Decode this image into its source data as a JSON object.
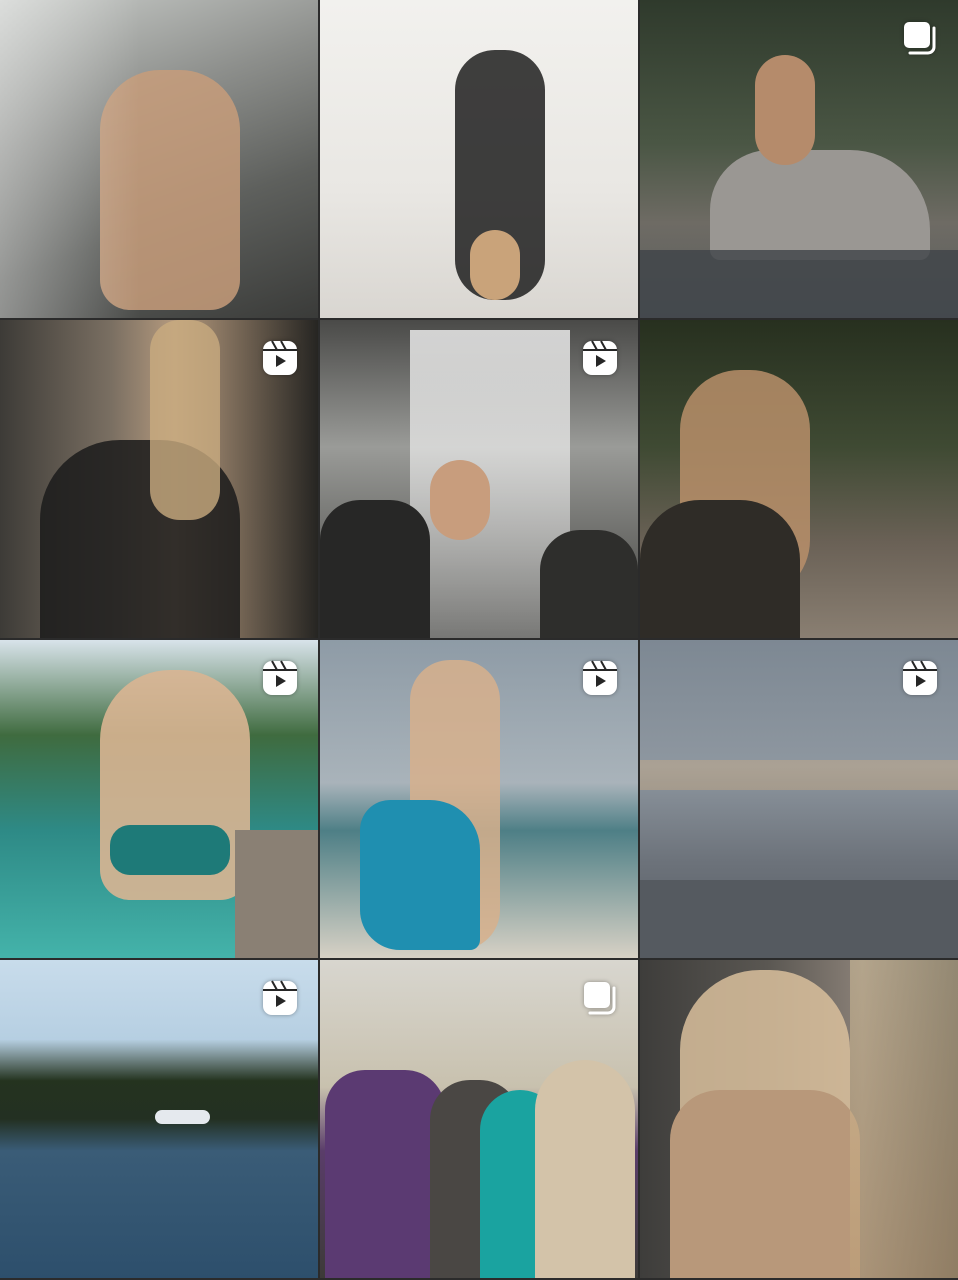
{
  "grid": {
    "tiles": [
      {
        "type": "carousel-icon"
      },
      {
        "type": null
      },
      {
        "type": "carousel-icon"
      },
      {
        "type": "reel-icon"
      },
      {
        "type": "reel-icon"
      },
      {
        "type": null
      },
      {
        "type": "reel-icon"
      },
      {
        "type": "reel-icon"
      },
      {
        "type": "reel-icon"
      },
      {
        "type": "reel-icon"
      },
      {
        "type": "carousel-icon"
      },
      {
        "type": null
      }
    ]
  },
  "colors": {
    "background": "#262626",
    "badge": "#ffffff"
  }
}
